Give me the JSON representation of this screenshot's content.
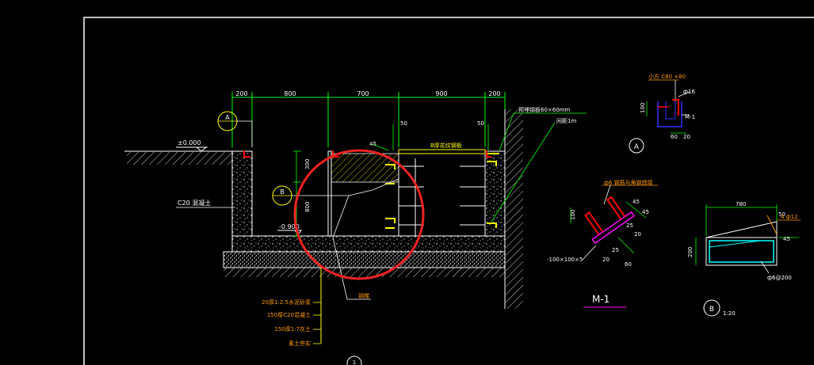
{
  "colors": {
    "background": "#000000",
    "frame": "#ffffff",
    "dimension": "#00ff00",
    "text_yellow": "#ffff00",
    "text_orange": "#ff9900",
    "steel_red": "#ff0000",
    "cyan": "#00ffff",
    "blue": "#3333ff",
    "magenta": "#ff00ff",
    "highlight_circle": "#ee2222"
  },
  "section": {
    "dims_top": [
      "200",
      "800",
      "700",
      "900",
      "200"
    ],
    "dim_50_a": "50",
    "dim_50_b": "50",
    "dim_45": "45",
    "dim_300": "300",
    "dim_800": "800",
    "level_top": "±0.000",
    "level_bottom": "-0.900",
    "concrete_label": "C20 混凝土",
    "cover_label": "B厚花纹钢板",
    "note_right_1": "预埋钢板60×60mm",
    "note_right_2": "间距1m",
    "steel_label": "钢梯",
    "layers": [
      "20厚1:2.5水泥砂浆",
      "150厚C20混凝土",
      "150厚1:7灰土",
      "素土夯实"
    ],
    "bubble_a": "A",
    "bubble_b": "B",
    "bubble_bottom": "1"
  },
  "detail_a": {
    "label_top": "小方 C80 ×80",
    "dim_phi": "ф16",
    "dim_100": "100",
    "dim_60": "60",
    "dim_20": "20",
    "tag": "M-1",
    "bubble": "A"
  },
  "detail_m1": {
    "note": "ф6 钢筋与角钢焊接",
    "dims": [
      "45",
      "45",
      "25",
      "20",
      "25",
      "20",
      "60",
      "100"
    ],
    "plate_note": "-100×100×5",
    "title": "M-1"
  },
  "detail_b": {
    "dim_top": "780",
    "dim_50": "50",
    "dim_200": "200",
    "dim_side": "45",
    "note_rebar": "4 ф12",
    "note_stirrup": "ф6@200",
    "bubble": "B",
    "scale": "1:20"
  }
}
